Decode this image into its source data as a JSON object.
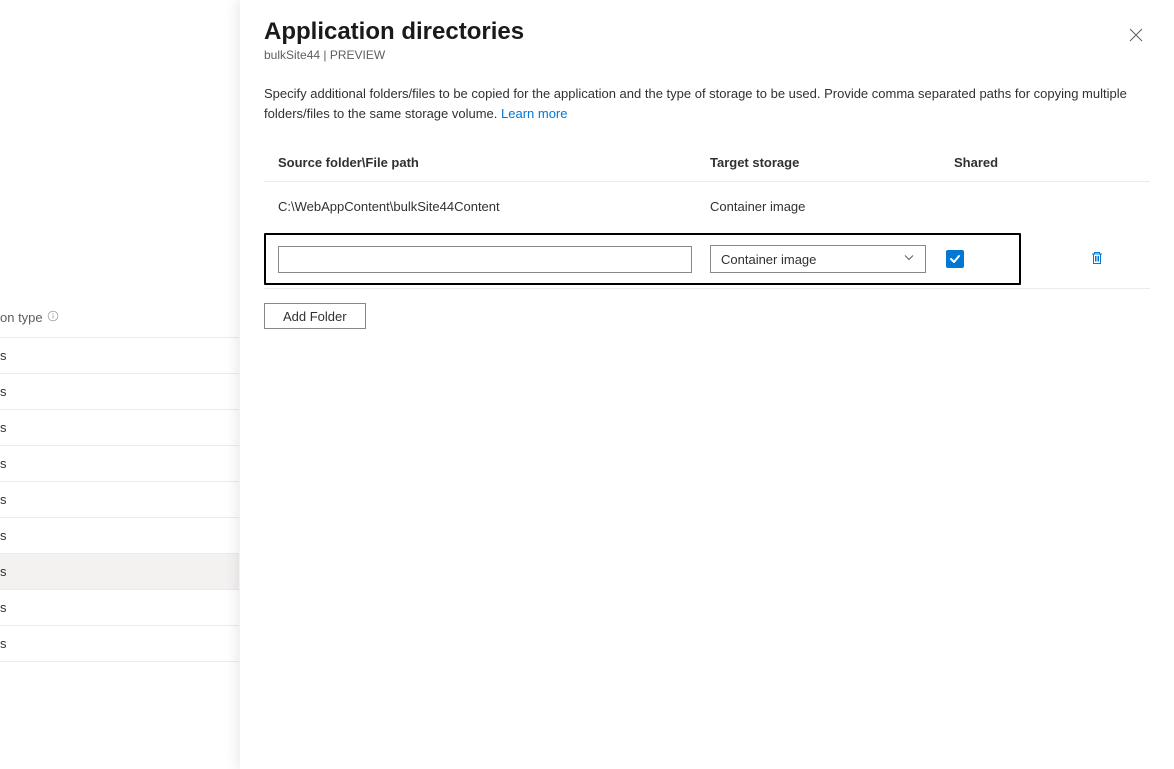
{
  "sidebar": {
    "header": "on type",
    "items": [
      {
        "label": "s"
      },
      {
        "label": "s"
      },
      {
        "label": "s"
      },
      {
        "label": "s"
      },
      {
        "label": "s"
      },
      {
        "label": "s"
      },
      {
        "label": "s",
        "selected": true
      },
      {
        "label": "s"
      },
      {
        "label": "s"
      }
    ]
  },
  "panel": {
    "title": "Application directories",
    "subtitle": "bulkSite44 | PREVIEW",
    "description_pre": "Specify additional folders/files to be copied for the application and the type of storage to be used. Provide comma separated paths for copying multiple folders/files to the same storage volume. ",
    "learn_more": "Learn more"
  },
  "table": {
    "headers": {
      "source": "Source folder\\File path",
      "target": "Target storage",
      "shared": "Shared"
    },
    "rows": [
      {
        "source": "C:\\WebAppContent\\bulkSite44Content",
        "target": "Container image",
        "shared": ""
      }
    ],
    "edit_row": {
      "source_value": "",
      "target_value": "Container image",
      "shared_checked": true
    }
  },
  "buttons": {
    "add_folder": "Add Folder"
  }
}
